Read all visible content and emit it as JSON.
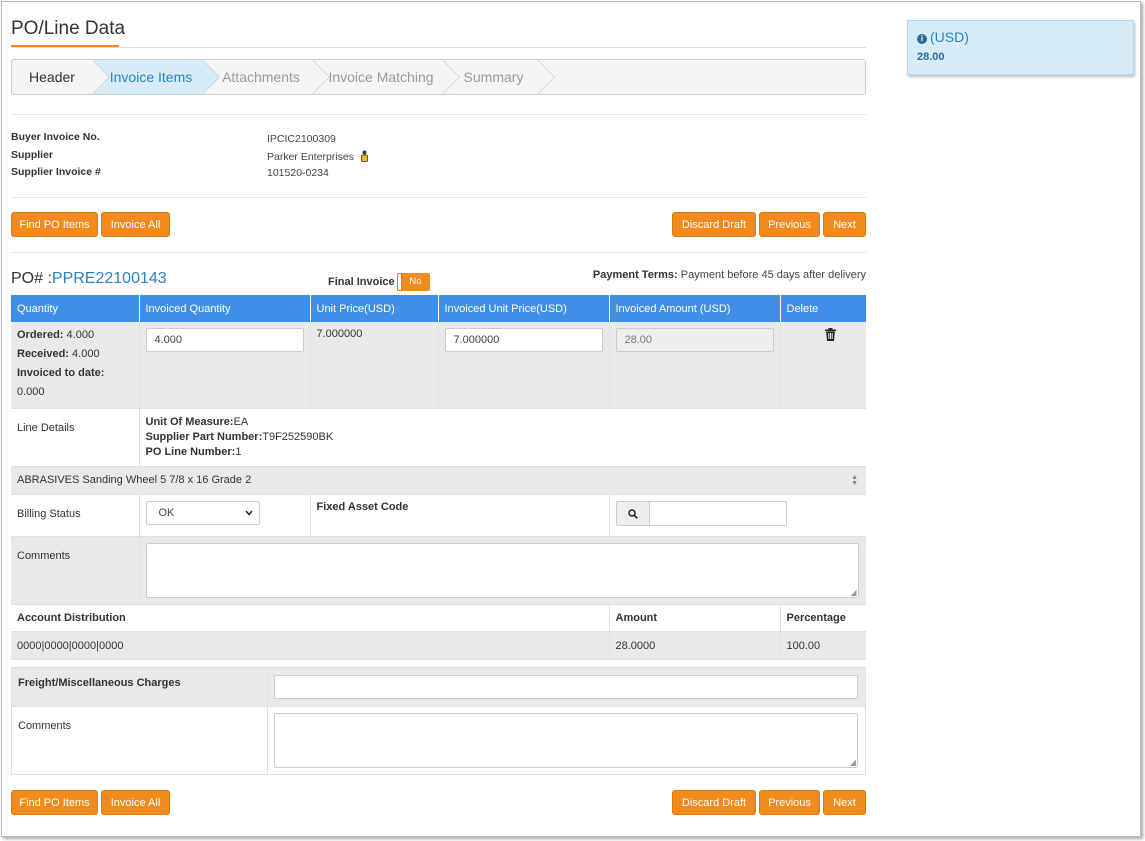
{
  "page": {
    "title": "PO/Line Data"
  },
  "wizard": {
    "steps": [
      "Header",
      "Invoice Items",
      "Attachments",
      "Invoice Matching",
      "Summary"
    ],
    "active_index": 1
  },
  "info": {
    "buyer_invoice_label": "Buyer Invoice No.",
    "buyer_invoice_value": "IPCIC2100309",
    "supplier_label": "Supplier",
    "supplier_value": "Parker Enterprises",
    "supplier_invoice_label": "Supplier Invoice #",
    "supplier_invoice_value": "101520-0234"
  },
  "buttons": {
    "find_po": "Find PO Items",
    "invoice_all": "Invoice All",
    "discard": "Discard Draft",
    "previous": "Previous",
    "next": "Next"
  },
  "po": {
    "label": "PO# :",
    "number": "PPRE22100143",
    "final_invoice_label": "Final Invoice :",
    "final_invoice_value": "No",
    "payment_terms_label": "Payment Terms:",
    "payment_terms_value": "Payment before 45 days after delivery"
  },
  "grid": {
    "headers": [
      "Quantity",
      "Invoiced Quantity",
      "Unit Price(USD)",
      "Invoiced Unit Price(USD)",
      "Invoiced Amount (USD)",
      "Delete"
    ],
    "ordered_label": "Ordered:",
    "ordered_value": "4.000",
    "received_label": "Received:",
    "received_value": "4.000",
    "invoiced_label": "Invoiced to date:",
    "invoiced_value": "0.000",
    "invoiced_qty": "4.000",
    "unit_price": "7.000000",
    "invoiced_unit_price": "7.000000",
    "invoiced_amount": "28.00",
    "line_details_label": "Line Details",
    "uom_label": "Unit Of Measure:",
    "uom_value": "EA",
    "spn_label": "Supplier Part Number:",
    "spn_value": "T9F252590BK",
    "poline_label": "PO Line Number:",
    "poline_value": "1",
    "description": "ABRASIVES Sanding Wheel 5 7/8 x 16  Grade 2",
    "billing_status_label": "Billing Status",
    "billing_status_value": "OK",
    "fixed_asset_label": "Fixed Asset Code",
    "comments_label": "Comments",
    "acct_dist_label": "Account Distribution",
    "amount_label": "Amount",
    "percentage_label": "Percentage",
    "acct_value": "0000|0000|0000|0000",
    "acct_amount": "28.0000",
    "acct_percentage": "100.00"
  },
  "freight": {
    "label": "Freight/Miscellaneous Charges",
    "comments_label": "Comments"
  },
  "summary": {
    "currency": "(USD)",
    "amount": "28.00"
  }
}
